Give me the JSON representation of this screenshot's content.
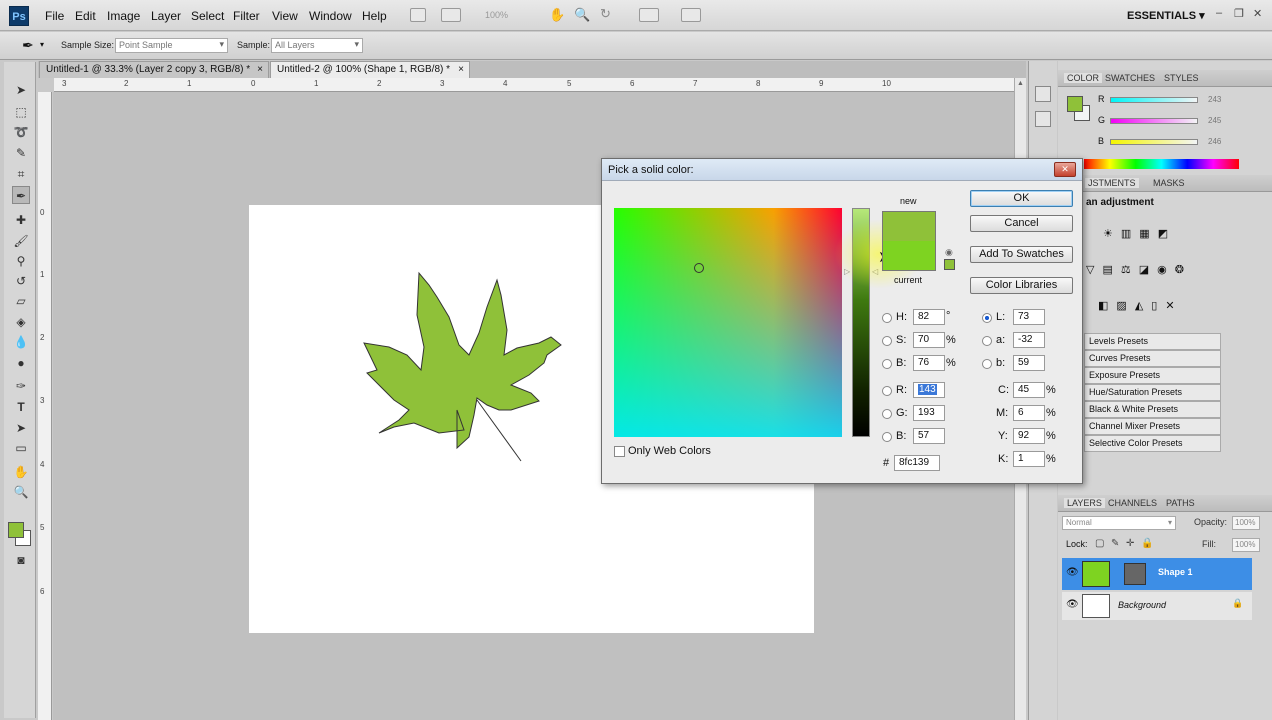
{
  "app": {
    "logo": "Ps",
    "workspace": "ESSENTIALS",
    "zoom": "100%"
  },
  "menu": [
    "File",
    "Edit",
    "Image",
    "Layer",
    "Select",
    "Filter",
    "View",
    "Window",
    "Help"
  ],
  "options_bar": {
    "sample_size_label": "Sample Size:",
    "sample_size_value": "Point Sample",
    "sample_label": "Sample:",
    "sample_value": "All Layers"
  },
  "doc_tabs": [
    {
      "label": "Untitled-1 @ 33.3% (Layer 2 copy 3, RGB/8) *",
      "close": "×"
    },
    {
      "label": "Untitled-2 @ 100% (Shape 1, RGB/8) *",
      "close": "×"
    }
  ],
  "ruler_h": [
    "3",
    "2",
    "1",
    "0",
    "1",
    "2",
    "3",
    "4",
    "5",
    "6",
    "7",
    "8",
    "9",
    "10"
  ],
  "ruler_v": [
    "0",
    "1",
    "2",
    "3",
    "4",
    "5",
    "6"
  ],
  "color_panel": {
    "tabs": [
      "COLOR",
      "SWATCHES",
      "STYLES"
    ],
    "r_label": "R",
    "g_label": "G",
    "b_label": "B",
    "r": "243",
    "g": "245",
    "b": "246",
    "foreground": "#8fc139"
  },
  "adjustments_panel": {
    "tabs": [
      "ADJUSTMENTS",
      "MASKS"
    ],
    "visible_tab_text": "JSTMENTS",
    "heading": "an adjustment",
    "presets": [
      "Levels Presets",
      "Curves Presets",
      "Exposure Presets",
      "Hue/Saturation Presets",
      "Black & White Presets",
      "Channel Mixer Presets",
      "Selective Color Presets"
    ]
  },
  "layers_panel": {
    "tabs": [
      "LAYERS",
      "CHANNELS",
      "PATHS"
    ],
    "blend_mode": "Normal",
    "opacity_label": "Opacity:",
    "opacity": "100%",
    "lock_label": "Lock:",
    "fill_label": "Fill:",
    "fill": "100%",
    "layers": [
      {
        "name": "Shape 1",
        "selected": true
      },
      {
        "name": "Background",
        "selected": false
      }
    ]
  },
  "color_picker": {
    "title": "Pick a solid color:",
    "new_label": "new",
    "current_label": "current",
    "buttons": {
      "ok": "OK",
      "cancel": "Cancel",
      "add_swatches": "Add To Swatches",
      "color_libraries": "Color Libraries"
    },
    "only_web_colors": "Only Web Colors",
    "hsb": {
      "h_label": "H:",
      "h": "82",
      "h_unit": "°",
      "s_label": "S:",
      "s": "70",
      "s_unit": "%",
      "b_label": "B:",
      "b": "76",
      "b_unit": "%"
    },
    "rgb": {
      "r_label": "R:",
      "r": "143",
      "g_label": "G:",
      "g": "193",
      "b_label": "B:",
      "b": "57"
    },
    "lab": {
      "l_label": "L:",
      "l": "73",
      "a_label": "a:",
      "a": "-32",
      "b_label": "b:",
      "b": "59"
    },
    "cmyk": {
      "c_label": "C:",
      "c": "45",
      "m_label": "M:",
      "m": "6",
      "y_label": "Y:",
      "y": "92",
      "k_label": "K:",
      "k": "1",
      "unit": "%"
    },
    "hex_label": "#",
    "hex": "8fc139",
    "new_color": "#8fc139",
    "current_color": "#7ed321"
  }
}
